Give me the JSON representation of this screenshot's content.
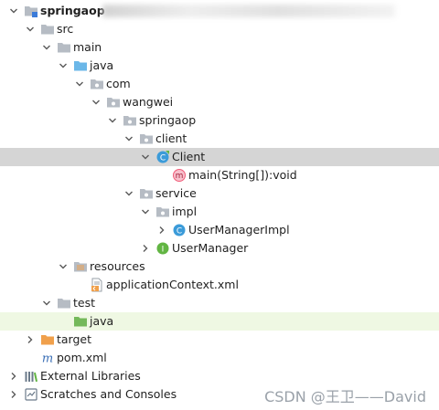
{
  "tree": {
    "project_name": "springaop",
    "src": "src",
    "main": "main",
    "java_main": "java",
    "com": "com",
    "wangwei": "wangwei",
    "springaop_pkg": "springaop",
    "client_pkg": "client",
    "client_class": "Client",
    "main_method": "main(String[]):void",
    "service_pkg": "service",
    "impl_pkg": "impl",
    "user_manager_impl": "UserManagerImpl",
    "user_manager": "UserManager",
    "resources": "resources",
    "application_context": "applicationContext.xml",
    "test": "test",
    "java_test": "java",
    "target": "target",
    "pom": "pom.xml",
    "external_libraries": "External Libraries",
    "scratches": "Scratches and Consoles"
  },
  "icons": {
    "class_badge": "C",
    "method_badge": "m",
    "interface_badge": "I",
    "pom_badge": "m"
  },
  "colors": {
    "selection": "#d5d5d5",
    "test_source_highlight": "#eff8e3",
    "folder": "#b6bcc4",
    "source_folder": "#6bb7e8",
    "test_folder": "#74b95a",
    "excluded_folder": "#f0a04b",
    "class_icon": "#3b9bd9",
    "interface_icon": "#62b543",
    "method_icon": "#f25b78"
  },
  "watermark": "CSDN @王卫——David"
}
